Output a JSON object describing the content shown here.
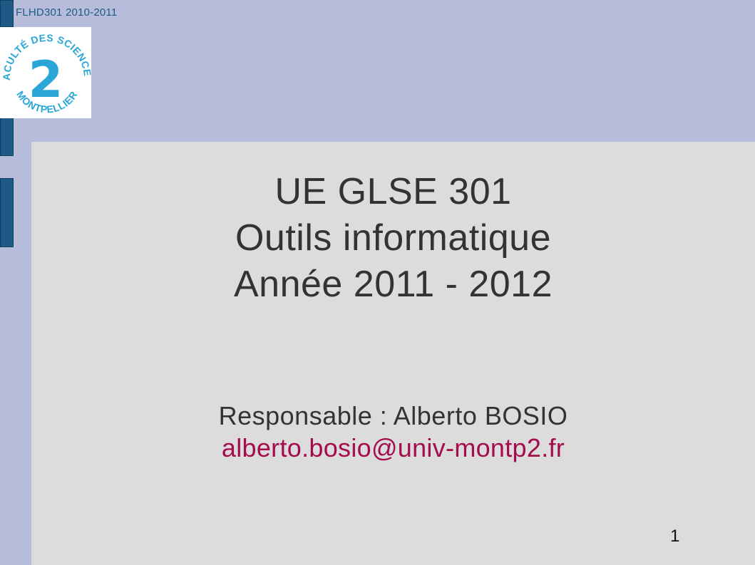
{
  "header": {
    "course_code": "FLHD301 2010-2011"
  },
  "logo": {
    "text_top": "FACULTÉ DES SCIENCES",
    "numeral": "2",
    "text_bottom": "MONTPELLIER"
  },
  "slide": {
    "title_line1": "UE GLSE 301",
    "title_line2": "Outils informatique",
    "title_line3": "Année 2011 - 2012",
    "responsable": "Responsable : Alberto BOSIO",
    "email": "alberto.bosio@univ-montp2.fr",
    "page_number": "1"
  },
  "colors": {
    "background": "#b8bcdb",
    "content_panel": "#dcdcdc",
    "accent_bar": "#1d5b86",
    "logo_blue": "#2aa6d6",
    "email": "#a50c4e",
    "text": "#333333"
  }
}
